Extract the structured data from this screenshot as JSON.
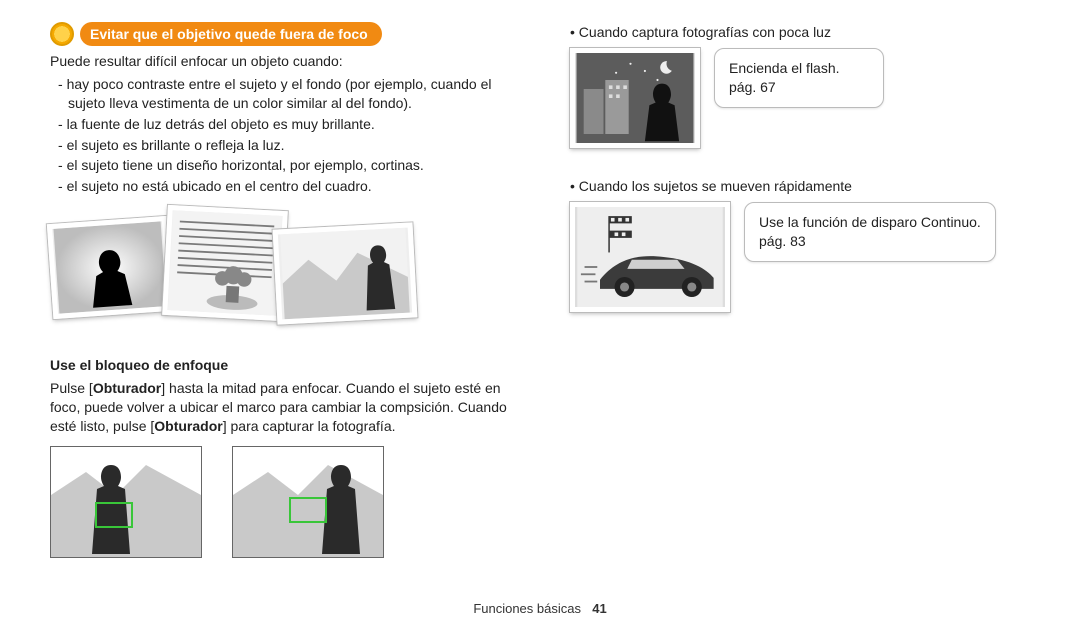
{
  "heading": "Evitar que el objetivo quede fuera de foco",
  "intro": "Puede resultar difícil enfocar un objeto cuando:",
  "difficult_cases": [
    "hay poco contraste entre el sujeto y el fondo (por ejemplo, cuando el sujeto lleva vestimenta de un color similar al del fondo).",
    "la fuente de luz detrás del objeto es muy brillante.",
    "el sujeto es brillante o refleja la luz.",
    "el sujeto tiene un diseño horizontal, por ejemplo, cortinas.",
    "el sujeto no está ubicado en el centro del cuadro."
  ],
  "focus_lock": {
    "title": "Use el bloqueo de enfoque",
    "text_parts": {
      "a": "Pulse [",
      "b": "Obturador",
      "c": "] hasta la mitad para enfocar. Cuando el sujeto esté en foco, puede volver a ubicar el marco para cambiar la compsición. Cuando esté listo, pulse [",
      "d": "Obturador",
      "e": "] para capturar la fotografía."
    }
  },
  "right_tips": [
    {
      "bullet": "Cuando captura fotografías con poca luz",
      "tip": "Encienda el flash.",
      "page": "pág. 67"
    },
    {
      "bullet": "Cuando los sujetos se mueven rápidamente",
      "tip": "Use la función de disparo Continuo.",
      "page": "pág. 83"
    }
  ],
  "footer": {
    "section": "Funciones básicas",
    "page": "41"
  }
}
